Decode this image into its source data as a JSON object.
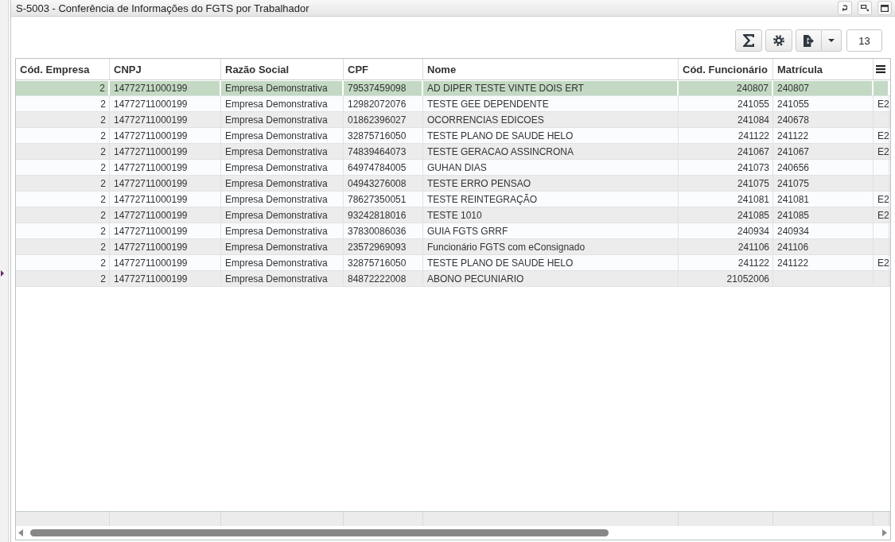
{
  "window": {
    "title": "S-5003 - Conferência de Informações do FGTS por Trabalhador"
  },
  "toolbar": {
    "record_count": "13"
  },
  "table": {
    "columns": [
      "Cód. Empresa",
      "CNPJ",
      "Razão Social",
      "CPF",
      "Nome",
      "Cód. Funcionário",
      "Matrícula"
    ],
    "rows": [
      {
        "selected": true,
        "cod_empresa": "2",
        "cnpj": "14772711000199",
        "razao_social": "Empresa Demonstrativa",
        "cpf": "79537459098",
        "nome": "AD DIPER TESTE VINTE DOIS ERT",
        "cod_funcionario": "240807",
        "matricula": "240807"
      },
      {
        "selected": false,
        "cod_empresa": "2",
        "cnpj": "14772711000199",
        "razao_social": "Empresa Demonstrativa",
        "cpf": "12982072076",
        "nome": "TESTE GEE DEPENDENTE",
        "cod_funcionario": "241055",
        "matricula": "241055",
        "column_8": "E2"
      },
      {
        "selected": false,
        "cod_empresa": "2",
        "cnpj": "14772711000199",
        "razao_social": "Empresa Demonstrativa",
        "cpf": "01862396027",
        "nome": "OCORRENCIAS EDICOES",
        "cod_funcionario": "241084",
        "matricula": "240678"
      },
      {
        "selected": false,
        "cod_empresa": "2",
        "cnpj": "14772711000199",
        "razao_social": "Empresa Demonstrativa",
        "cpf": "32875716050",
        "nome": "TESTE PLANO DE SAUDE HELO",
        "cod_funcionario": "241122",
        "matricula": "241122",
        "column_8": "E2"
      },
      {
        "selected": false,
        "cod_empresa": "2",
        "cnpj": "14772711000199",
        "razao_social": "Empresa Demonstrativa",
        "cpf": "74839464073",
        "nome": "TESTE GERACAO ASSINCRONA",
        "cod_funcionario": "241067",
        "matricula": "241067",
        "column_8": "E2"
      },
      {
        "selected": false,
        "cod_empresa": "2",
        "cnpj": "14772711000199",
        "razao_social": "Empresa Demonstrativa",
        "cpf": "64974784005",
        "nome": "GUHAN DIAS",
        "cod_funcionario": "241073",
        "matricula": "240656"
      },
      {
        "selected": false,
        "cod_empresa": "2",
        "cnpj": "14772711000199",
        "razao_social": "Empresa Demonstrativa",
        "cpf": "04943276008",
        "nome": "TESTE ERRO PENSAO",
        "cod_funcionario": "241075",
        "matricula": "241075"
      },
      {
        "selected": false,
        "cod_empresa": "2",
        "cnpj": "14772711000199",
        "razao_social": "Empresa Demonstrativa",
        "cpf": "78627350051",
        "nome": "TESTE REINTEGRAÇÃO",
        "cod_funcionario": "241081",
        "matricula": "241081",
        "column_8": "E2"
      },
      {
        "selected": false,
        "cod_empresa": "2",
        "cnpj": "14772711000199",
        "razao_social": "Empresa Demonstrativa",
        "cpf": "93242818016",
        "nome": "TESTE 1010",
        "cod_funcionario": "241085",
        "matricula": "241085",
        "column_8": "E2"
      },
      {
        "selected": false,
        "cod_empresa": "2",
        "cnpj": "14772711000199",
        "razao_social": "Empresa Demonstrativa",
        "cpf": "37830086036",
        "nome": "GUIA FGTS GRRF",
        "cod_funcionario": "240934",
        "matricula": "240934"
      },
      {
        "selected": false,
        "cod_empresa": "2",
        "cnpj": "14772711000199",
        "razao_social": "Empresa Demonstrativa",
        "cpf": "23572969093",
        "nome": "Funcionário FGTS com eConsignado",
        "cod_funcionario": "241106",
        "matricula": "241106"
      },
      {
        "selected": false,
        "cod_empresa": "2",
        "cnpj": "14772711000199",
        "razao_social": "Empresa Demonstrativa",
        "cpf": "32875716050",
        "nome": "TESTE PLANO DE SAUDE HELO",
        "cod_funcionario": "241122",
        "matricula": "241122",
        "column_8": "E2"
      },
      {
        "selected": false,
        "cod_empresa": "2",
        "cnpj": "14772711000199",
        "razao_social": "Empresa Demonstrativa",
        "cpf": "84872222008",
        "nome": "ABONO PECUNIARIO",
        "cod_funcionario": "21052006"
      }
    ]
  }
}
